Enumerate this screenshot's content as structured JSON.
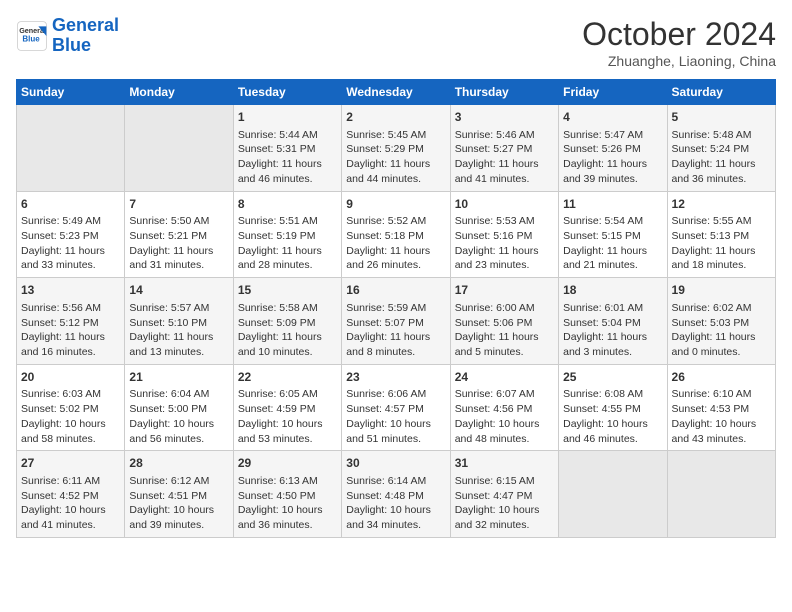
{
  "header": {
    "logo_line1": "General",
    "logo_line2": "Blue",
    "month_year": "October 2024",
    "location": "Zhuanghe, Liaoning, China"
  },
  "weekdays": [
    "Sunday",
    "Monday",
    "Tuesday",
    "Wednesday",
    "Thursday",
    "Friday",
    "Saturday"
  ],
  "weeks": [
    [
      {
        "day": "",
        "info": ""
      },
      {
        "day": "",
        "info": ""
      },
      {
        "day": "1",
        "info": "Sunrise: 5:44 AM\nSunset: 5:31 PM\nDaylight: 11 hours and 46 minutes."
      },
      {
        "day": "2",
        "info": "Sunrise: 5:45 AM\nSunset: 5:29 PM\nDaylight: 11 hours and 44 minutes."
      },
      {
        "day": "3",
        "info": "Sunrise: 5:46 AM\nSunset: 5:27 PM\nDaylight: 11 hours and 41 minutes."
      },
      {
        "day": "4",
        "info": "Sunrise: 5:47 AM\nSunset: 5:26 PM\nDaylight: 11 hours and 39 minutes."
      },
      {
        "day": "5",
        "info": "Sunrise: 5:48 AM\nSunset: 5:24 PM\nDaylight: 11 hours and 36 minutes."
      }
    ],
    [
      {
        "day": "6",
        "info": "Sunrise: 5:49 AM\nSunset: 5:23 PM\nDaylight: 11 hours and 33 minutes."
      },
      {
        "day": "7",
        "info": "Sunrise: 5:50 AM\nSunset: 5:21 PM\nDaylight: 11 hours and 31 minutes."
      },
      {
        "day": "8",
        "info": "Sunrise: 5:51 AM\nSunset: 5:19 PM\nDaylight: 11 hours and 28 minutes."
      },
      {
        "day": "9",
        "info": "Sunrise: 5:52 AM\nSunset: 5:18 PM\nDaylight: 11 hours and 26 minutes."
      },
      {
        "day": "10",
        "info": "Sunrise: 5:53 AM\nSunset: 5:16 PM\nDaylight: 11 hours and 23 minutes."
      },
      {
        "day": "11",
        "info": "Sunrise: 5:54 AM\nSunset: 5:15 PM\nDaylight: 11 hours and 21 minutes."
      },
      {
        "day": "12",
        "info": "Sunrise: 5:55 AM\nSunset: 5:13 PM\nDaylight: 11 hours and 18 minutes."
      }
    ],
    [
      {
        "day": "13",
        "info": "Sunrise: 5:56 AM\nSunset: 5:12 PM\nDaylight: 11 hours and 16 minutes."
      },
      {
        "day": "14",
        "info": "Sunrise: 5:57 AM\nSunset: 5:10 PM\nDaylight: 11 hours and 13 minutes."
      },
      {
        "day": "15",
        "info": "Sunrise: 5:58 AM\nSunset: 5:09 PM\nDaylight: 11 hours and 10 minutes."
      },
      {
        "day": "16",
        "info": "Sunrise: 5:59 AM\nSunset: 5:07 PM\nDaylight: 11 hours and 8 minutes."
      },
      {
        "day": "17",
        "info": "Sunrise: 6:00 AM\nSunset: 5:06 PM\nDaylight: 11 hours and 5 minutes."
      },
      {
        "day": "18",
        "info": "Sunrise: 6:01 AM\nSunset: 5:04 PM\nDaylight: 11 hours and 3 minutes."
      },
      {
        "day": "19",
        "info": "Sunrise: 6:02 AM\nSunset: 5:03 PM\nDaylight: 11 hours and 0 minutes."
      }
    ],
    [
      {
        "day": "20",
        "info": "Sunrise: 6:03 AM\nSunset: 5:02 PM\nDaylight: 10 hours and 58 minutes."
      },
      {
        "day": "21",
        "info": "Sunrise: 6:04 AM\nSunset: 5:00 PM\nDaylight: 10 hours and 56 minutes."
      },
      {
        "day": "22",
        "info": "Sunrise: 6:05 AM\nSunset: 4:59 PM\nDaylight: 10 hours and 53 minutes."
      },
      {
        "day": "23",
        "info": "Sunrise: 6:06 AM\nSunset: 4:57 PM\nDaylight: 10 hours and 51 minutes."
      },
      {
        "day": "24",
        "info": "Sunrise: 6:07 AM\nSunset: 4:56 PM\nDaylight: 10 hours and 48 minutes."
      },
      {
        "day": "25",
        "info": "Sunrise: 6:08 AM\nSunset: 4:55 PM\nDaylight: 10 hours and 46 minutes."
      },
      {
        "day": "26",
        "info": "Sunrise: 6:10 AM\nSunset: 4:53 PM\nDaylight: 10 hours and 43 minutes."
      }
    ],
    [
      {
        "day": "27",
        "info": "Sunrise: 6:11 AM\nSunset: 4:52 PM\nDaylight: 10 hours and 41 minutes."
      },
      {
        "day": "28",
        "info": "Sunrise: 6:12 AM\nSunset: 4:51 PM\nDaylight: 10 hours and 39 minutes."
      },
      {
        "day": "29",
        "info": "Sunrise: 6:13 AM\nSunset: 4:50 PM\nDaylight: 10 hours and 36 minutes."
      },
      {
        "day": "30",
        "info": "Sunrise: 6:14 AM\nSunset: 4:48 PM\nDaylight: 10 hours and 34 minutes."
      },
      {
        "day": "31",
        "info": "Sunrise: 6:15 AM\nSunset: 4:47 PM\nDaylight: 10 hours and 32 minutes."
      },
      {
        "day": "",
        "info": ""
      },
      {
        "day": "",
        "info": ""
      }
    ]
  ]
}
